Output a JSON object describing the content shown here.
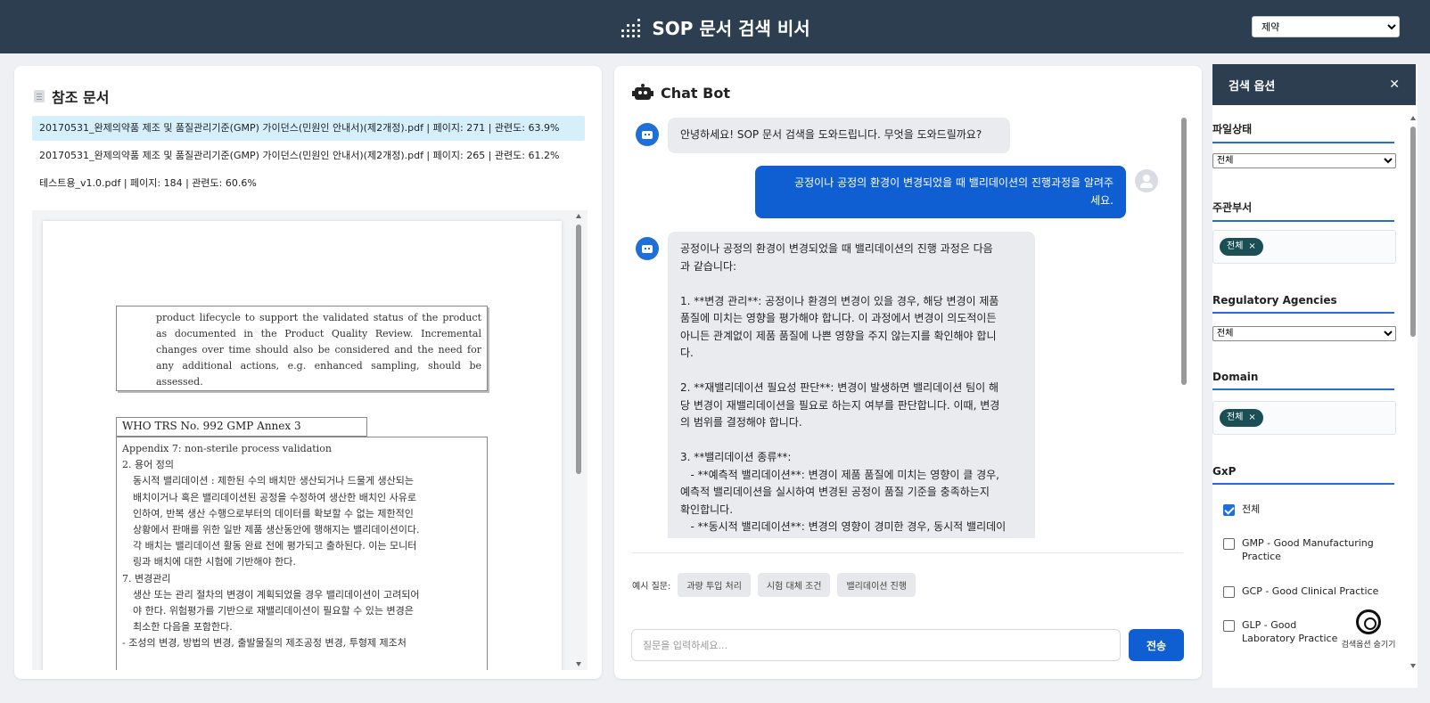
{
  "header": {
    "title": "SOP 문서 검색 비서",
    "industry_select": {
      "value": "제약"
    }
  },
  "references": {
    "title": "참조 문서",
    "items": [
      "20170531_완제의약품 제조 및 품질관리기준(GMP) 가이던스(민원인 안내서)(제2개정).pdf | 페이지: 271 | 관련도: 63.9%",
      "20170531_완제의약품 제조 및 품질관리기준(GMP) 가이던스(민원인 안내서)(제2개정).pdf | 페이지: 265 | 관련도: 61.2%",
      "테스트용_v1.0.pdf | 페이지: 184 | 관련도: 60.6%"
    ],
    "pdf": {
      "box1_text": "product lifecycle to support the validated status of the product as documented in the Product Quality Review. Incremental changes over time should also be considered and the need for any additional actions, e.g. enhanced sampling, should be assessed.",
      "box_title": "WHO TRS No. 992 GMP Annex 3",
      "lines": [
        "Appendix 7: non-sterile process validation",
        "2. 용어 정의",
        "동시적 밸리데이션 : 제한된 수의 배치만 생산되거나 드물게 생산되는",
        "배치이거나 혹은 밸리데이션된 공정을 수정하여 생산한 배치인 사유로",
        "인하여, 반복 생산 수행으로부터의 데이터를 확보할 수 없는 제한적인",
        "상황에서 판매를 위한 일반 제품 생산동안에 행해지는 밸리데이션이다.",
        "각 배치는 밸리데이션 활동 완료 전에 평가되고 출하된다. 이는 모니터",
        "링과 배치에 대한 시험에 기반해야 한다.",
        "7. 변경관리",
        "생산 또는 관리 절차의 변경이 계획되었을 경우 밸리데이션이 고려되어",
        "야 한다. 위험평가를 기반으로 재밸리데이션이 필요할 수 있는 변경은",
        "최소한 다음을 포함한다.",
        "- 조성의 변경, 방법의 변경, 출발물질의 제조공정 변경, 투형제 제조처"
      ]
    }
  },
  "chat": {
    "title": "Chat Bot",
    "messages": {
      "greeting": "안녕하세요! SOP 문서 검색을 도와드립니다. 무엇을 도와드릴까요?",
      "user_line1": "공정이나 공정의 환경이 변경되었을 때 밸리데이션의 진행과정을 알려주",
      "user_line2": "세요.",
      "answer_lines": [
        "공정이나 공정의 환경이 변경되었을 때 밸리데이션의 진행 과정은 다음",
        "과 같습니다:",
        "",
        "1. **변경 관리**: 공정이나 환경의 변경이 있을 경우, 해당 변경이 제품",
        "품질에 미치는 영향을 평가해야 합니다. 이 과정에서 변경이 의도적이든",
        "아니든 관계없이 제품 품질에 나쁜 영향을 주지 않는지를 확인해야 합니",
        "다.",
        "",
        "2. **재밸리데이션 필요성 판단**: 변경이 발생하면 밸리데이션 팀이 해",
        "당 변경이 재밸리데이션을 필요로 하는지 여부를 판단합니다. 이때, 변경",
        "의 범위를 결정해야 합니다.",
        "",
        "3. **밸리데이션 종류**:",
        "   - **예측적 밸리데이션**: 변경이 제품 품질에 미치는 영향이 클 경우,",
        "예측적 밸리데이션을 실시하여 변경된 공정이 품질 기준을 충족하는지",
        "확인합니다.",
        "   - **동시적 밸리데이션**: 변경의 영향이 경미한 경우, 동시적 밸리데이"
      ]
    },
    "examples_label": "예시 질문:",
    "examples": [
      "과량 투입 처리",
      "시험 대체 조건",
      "밸리데이션 진행"
    ],
    "input_placeholder": "질문을 입력하세요...",
    "send_label": "전송"
  },
  "options": {
    "title": "검색 옵션",
    "close_label": "✕",
    "file_status": {
      "label": "파일상태",
      "value": "전체"
    },
    "department": {
      "label": "주관부서",
      "tag": "전체"
    },
    "agencies": {
      "label": "Regulatory Agencies",
      "value": "전체"
    },
    "domain": {
      "label": "Domain",
      "tag": "전체"
    },
    "gxp": {
      "label": "GxP",
      "items": [
        {
          "label": "전체",
          "checked": true
        },
        {
          "label": "GMP - Good Manufacturing Practice",
          "checked": false
        },
        {
          "label": "GCP - Good Clinical Practice",
          "checked": false
        },
        {
          "label": "GLP - Good Laboratory Practice",
          "checked": false
        }
      ]
    },
    "hide_label": "검색옵션 숨기기"
  },
  "colors": {
    "header_bg": "#2c3e50",
    "accent_blue": "#0f5fd3",
    "tag_bg": "#1b4f56",
    "active_ref_bg": "#d6f0fb"
  }
}
